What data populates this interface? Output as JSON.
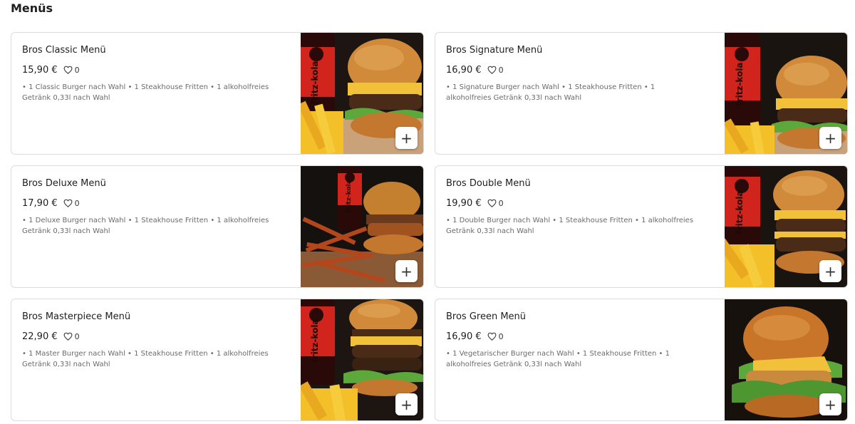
{
  "section": {
    "title": "Menüs"
  },
  "menus": [
    {
      "name": "Bros Classic Menü",
      "price": "15,90 €",
      "likes": "0",
      "description": "• 1 Classic Burger nach Wahl • 1 Steakhouse Fritten • 1 alkoholfreies Getränk 0,33l nach Wahl",
      "image": "burger-with-fries-and-cola-photo",
      "bottle_label": "fritz-kola"
    },
    {
      "name": "Bros Signature Menü",
      "price": "16,90 €",
      "likes": "0",
      "description": "• 1 Signature Burger nach Wahl • 1 Steakhouse Fritten • 1 alkoholfreies Getränk 0,33l nach Wahl",
      "image": "burger-with-fries-and-cola-photo",
      "bottle_label": "fritz-kola"
    },
    {
      "name": "Bros Deluxe Menü",
      "price": "17,90 €",
      "likes": "0",
      "description": "• 1 Deluxe Burger nach Wahl • 1 Steakhouse Fritten • 1 alkoholfreies Getränk 0,33l nach Wahl",
      "image": "burger-with-sweet-potato-fries-and-cola-photo",
      "bottle_label": "fritz-kola"
    },
    {
      "name": "Bros Double Menü",
      "price": "19,90 €",
      "likes": "0",
      "description": "• 1 Double Burger nach Wahl • 1 Steakhouse Fritten • 1 alkoholfreies Getränk 0,33l nach Wahl",
      "image": "double-burger-with-fries-and-cola-photo",
      "bottle_label": "fritz-kola"
    },
    {
      "name": "Bros Masterpiece Menü",
      "price": "22,90 €",
      "likes": "0",
      "description": "• 1 Master Burger nach Wahl • 1 Steakhouse Fritten • 1 alkoholfreies Getränk 0,33l nach Wahl",
      "image": "double-burger-with-fries-and-cola-photo",
      "bottle_label": "fritz-kola"
    },
    {
      "name": "Bros Green Menü",
      "price": "16,90 €",
      "likes": "0",
      "description": "• 1 Vegetarischer Burger nach Wahl • 1 Steakhouse Fritten • 1 alkoholfreies Getränk 0,33l nach Wahl",
      "image": "veggie-burger-photo"
    }
  ],
  "icons": {
    "favorite": "heart-outline-icon",
    "add": "plus-icon"
  },
  "add_symbol": "+",
  "colors": {
    "card_border": "#dcdcdc",
    "text": "#1e1e1e",
    "description": "#6b6b6b",
    "bun": "#d08a3a",
    "fries": "#f3c02a",
    "cola_bottle": "#2a0a08",
    "cola_label": "#d0241c"
  }
}
